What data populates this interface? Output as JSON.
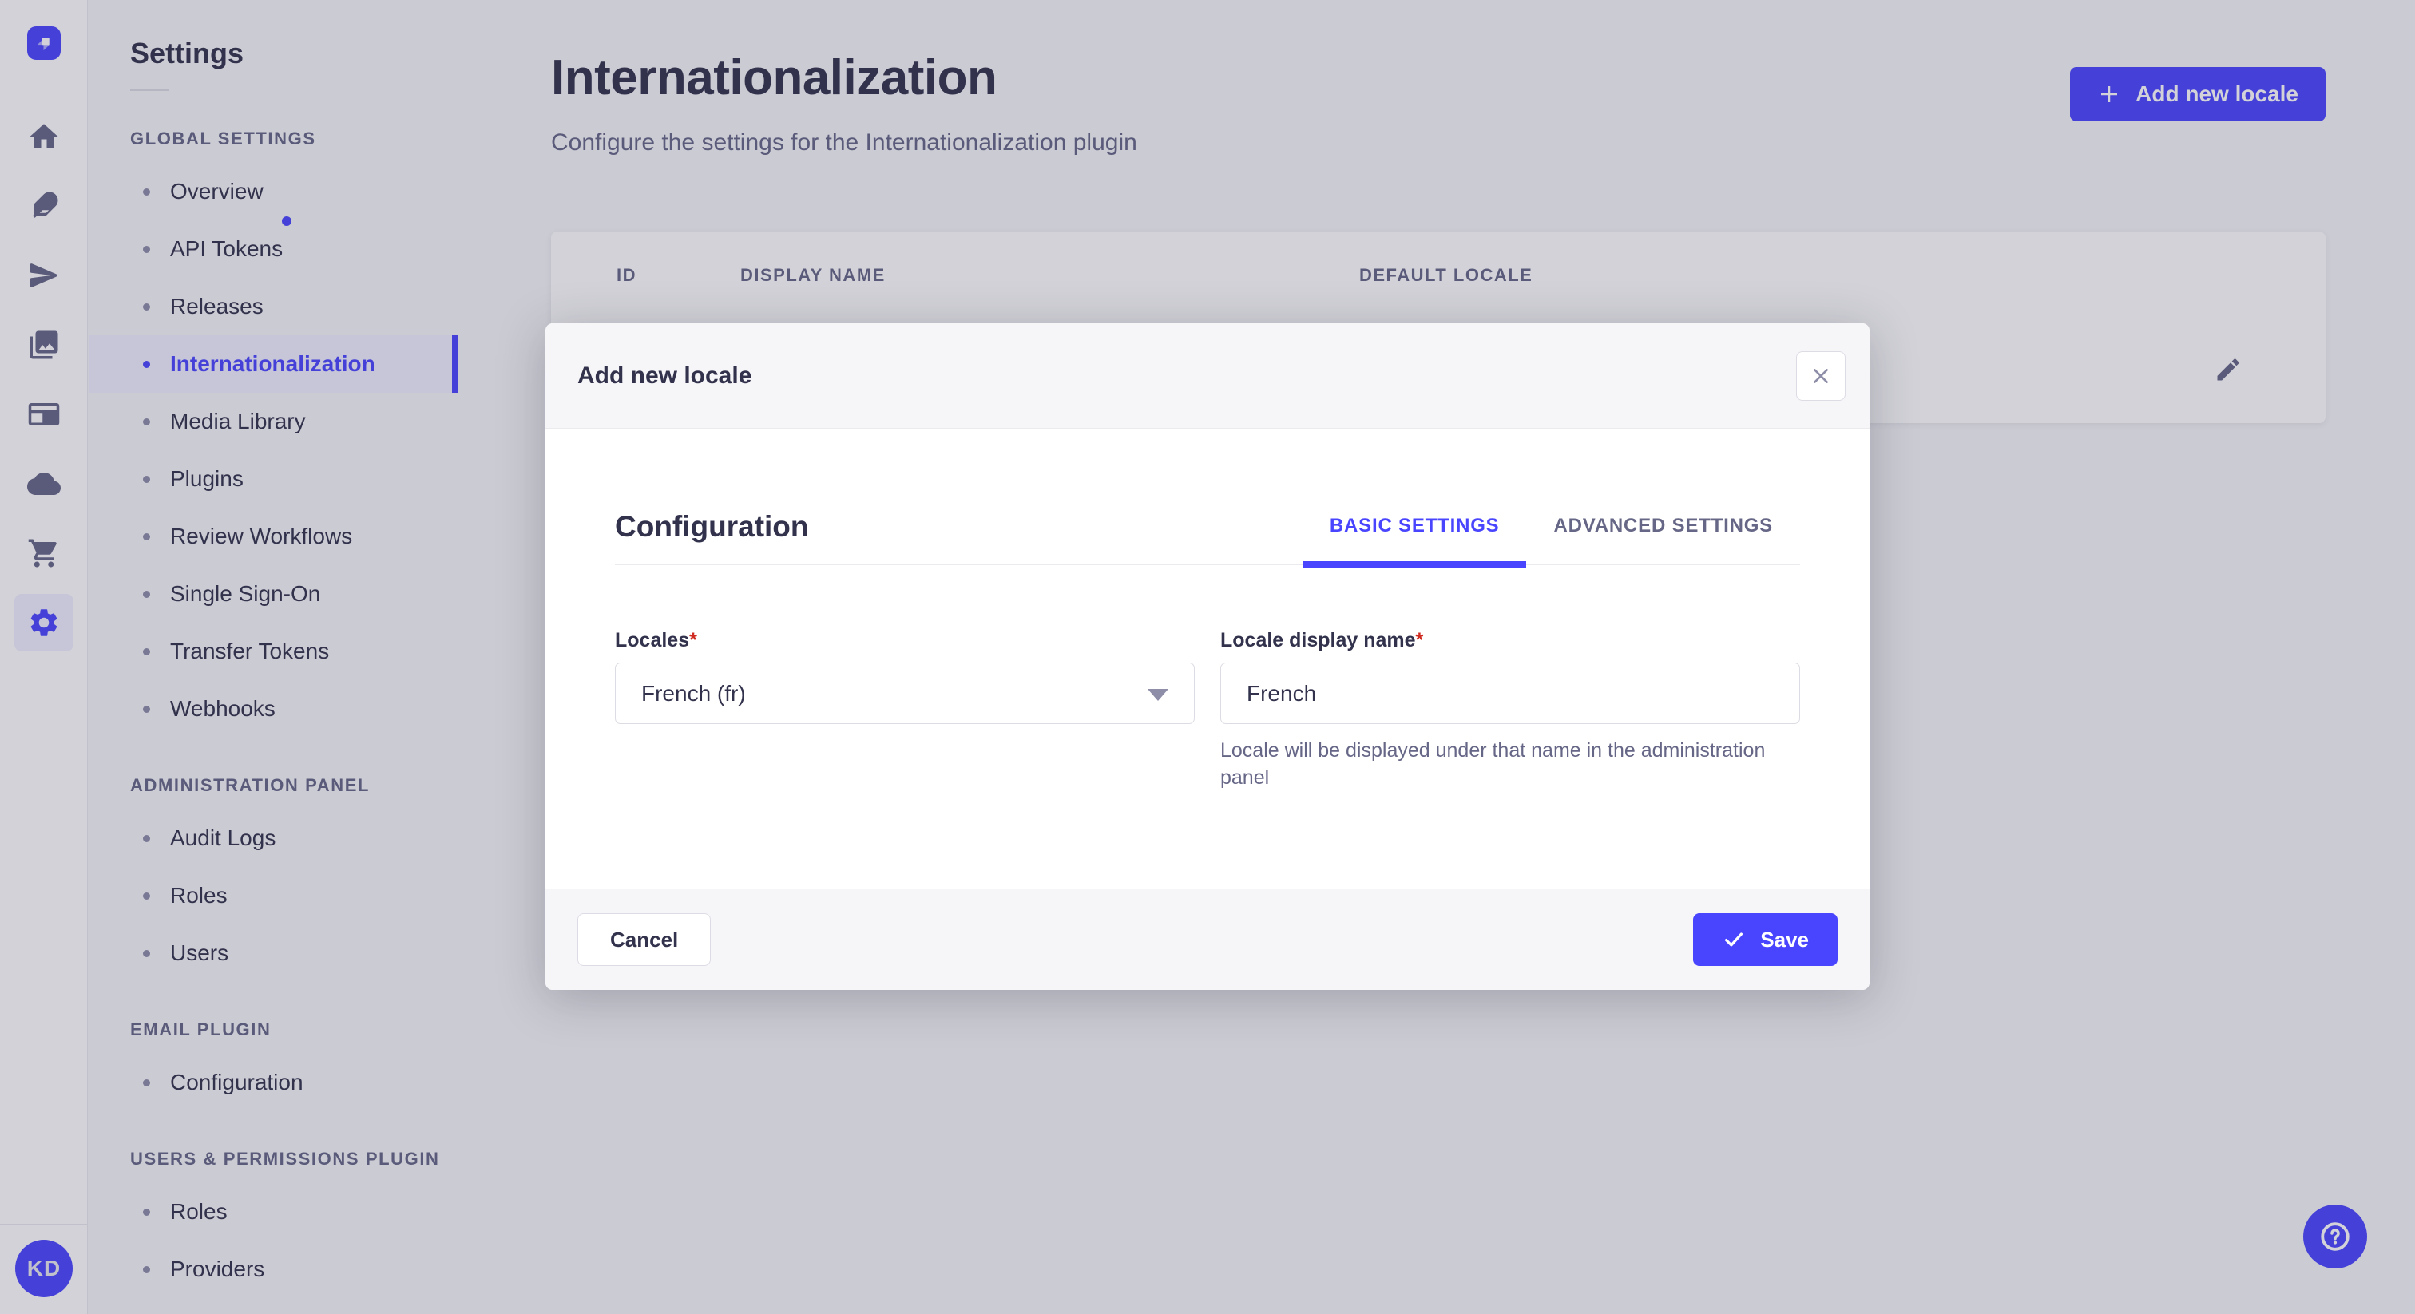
{
  "colors": {
    "accent": "#4945ff",
    "accent_soft": "#f0f0ff",
    "page_bg": "#f6f6f9",
    "text": "#32324d",
    "text_muted": "#666687",
    "border": "#dcdce4",
    "required": "#d02b20"
  },
  "rail": {
    "icons": [
      "strapi-logo",
      "home",
      "feather",
      "send",
      "media",
      "layout",
      "cloud",
      "cart",
      "settings-gear"
    ],
    "avatar_initials": "KD"
  },
  "settings_nav": {
    "title": "Settings",
    "sections": [
      {
        "label": "GLOBAL SETTINGS",
        "items": [
          {
            "label": "Overview"
          },
          {
            "label": "API Tokens"
          },
          {
            "label": "Releases"
          },
          {
            "label": "Internationalization"
          },
          {
            "label": "Media Library"
          },
          {
            "label": "Plugins"
          },
          {
            "label": "Review Workflows"
          },
          {
            "label": "Single Sign-On"
          },
          {
            "label": "Transfer Tokens"
          },
          {
            "label": "Webhooks"
          }
        ]
      },
      {
        "label": "ADMINISTRATION PANEL",
        "items": [
          {
            "label": "Audit Logs"
          },
          {
            "label": "Roles"
          },
          {
            "label": "Users"
          }
        ]
      },
      {
        "label": "EMAIL PLUGIN",
        "items": [
          {
            "label": "Configuration"
          }
        ]
      },
      {
        "label": "USERS & PERMISSIONS PLUGIN",
        "items": [
          {
            "label": "Roles"
          },
          {
            "label": "Providers"
          }
        ]
      }
    ]
  },
  "page": {
    "title": "Internationalization",
    "subtitle": "Configure the settings for the Internationalization plugin",
    "add_button_label": "Add new locale"
  },
  "table": {
    "columns": [
      "ID",
      "DISPLAY NAME",
      "DEFAULT LOCALE"
    ]
  },
  "modal": {
    "title": "Add new locale",
    "section_heading": "Configuration",
    "tabs": [
      {
        "label": "BASIC SETTINGS",
        "active": true
      },
      {
        "label": "ADVANCED SETTINGS",
        "active": false
      }
    ],
    "fields": {
      "locales": {
        "label": "Locales",
        "required_mark": "*",
        "value": "French (fr)"
      },
      "display_name": {
        "label": "Locale display name",
        "required_mark": "*",
        "value": "French",
        "hint": "Locale will be displayed under that name in the administration panel"
      }
    },
    "cancel_label": "Cancel",
    "save_label": "Save"
  }
}
